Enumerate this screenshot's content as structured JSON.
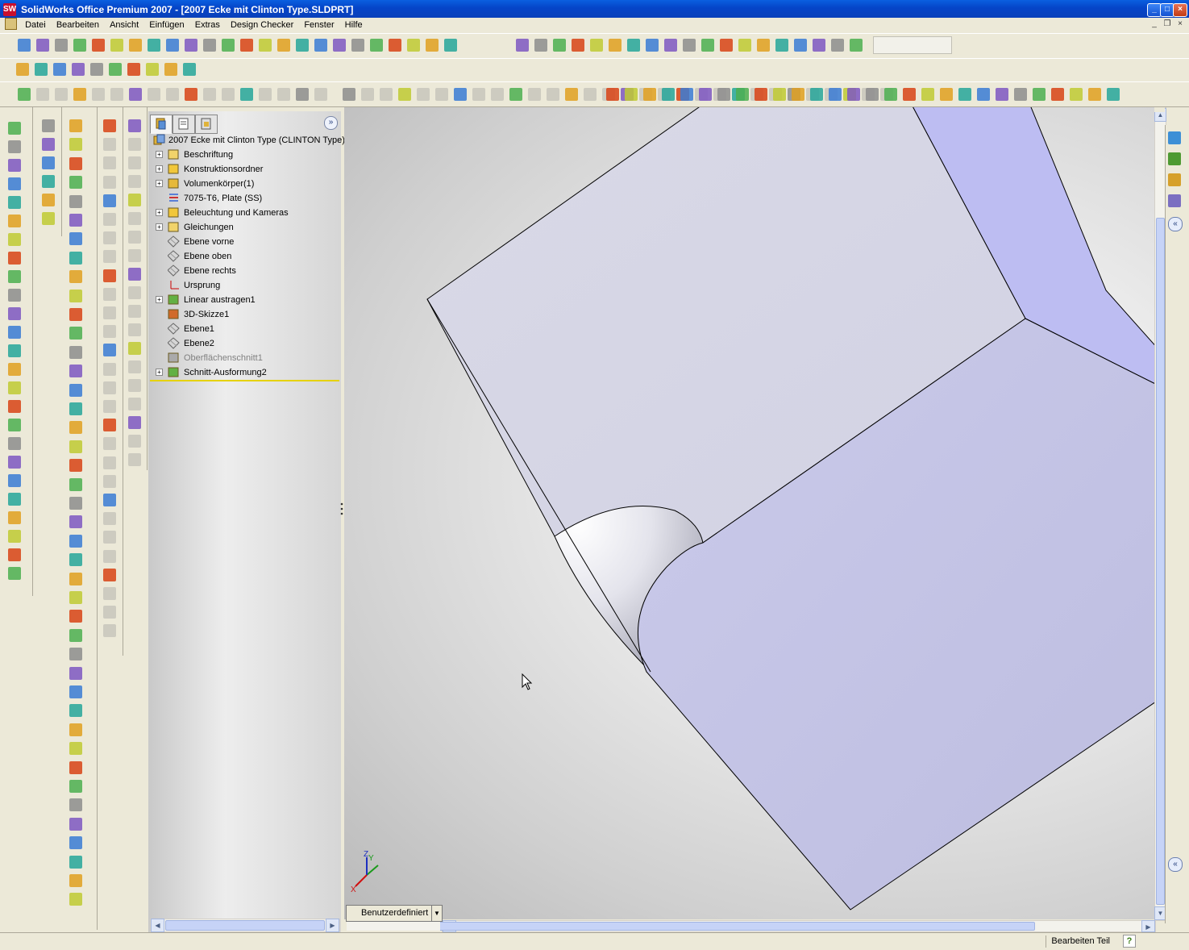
{
  "window": {
    "title": "SolidWorks Office Premium 2007 - [2007 Ecke mit Clinton Type.SLDPRT]",
    "app_icon_text": "SW",
    "min_label": "_",
    "max_label": "□",
    "close_label": "×"
  },
  "menu": [
    "Datei",
    "Bearbeiten",
    "Ansicht",
    "Einfügen",
    "Extras",
    "Design Checker",
    "Fenster",
    "Hilfe"
  ],
  "feature_tree": {
    "root": "2007 Ecke mit Clinton Type  (CLINTON Type)",
    "items": [
      {
        "label": "Beschriftung",
        "expandable": true,
        "dim": false,
        "icon": "annotation-icon"
      },
      {
        "label": "Konstruktionsordner",
        "expandable": true,
        "dim": false,
        "icon": "design-binder-icon"
      },
      {
        "label": "Volumenkörper(1)",
        "expandable": true,
        "dim": false,
        "icon": "solid-bodies-icon"
      },
      {
        "label": "7075-T6, Plate (SS)",
        "expandable": false,
        "dim": false,
        "icon": "material-icon"
      },
      {
        "label": "Beleuchtung und Kameras",
        "expandable": true,
        "dim": false,
        "icon": "lights-cameras-icon"
      },
      {
        "label": "Gleichungen",
        "expandable": true,
        "dim": false,
        "icon": "equations-icon"
      },
      {
        "label": "Ebene vorne",
        "expandable": false,
        "dim": false,
        "icon": "plane-icon"
      },
      {
        "label": "Ebene oben",
        "expandable": false,
        "dim": false,
        "icon": "plane-icon"
      },
      {
        "label": "Ebene rechts",
        "expandable": false,
        "dim": false,
        "icon": "plane-icon"
      },
      {
        "label": "Ursprung",
        "expandable": false,
        "dim": false,
        "icon": "origin-icon"
      },
      {
        "label": "Linear austragen1",
        "expandable": true,
        "dim": false,
        "icon": "extrude-icon"
      },
      {
        "label": "3D-Skizze1",
        "expandable": false,
        "dim": false,
        "icon": "3d-sketch-icon"
      },
      {
        "label": "Ebene1",
        "expandable": false,
        "dim": false,
        "icon": "plane-icon"
      },
      {
        "label": "Ebene2",
        "expandable": false,
        "dim": false,
        "icon": "plane-icon"
      },
      {
        "label": "Oberflächenschnitt1",
        "expandable": false,
        "dim": true,
        "icon": "surface-cut-icon"
      },
      {
        "label": "Schnitt-Ausformung2",
        "expandable": true,
        "dim": false,
        "icon": "loft-cut-icon"
      }
    ]
  },
  "view_orientation": "Benutzerdefiniert",
  "triad": {
    "z": "Z",
    "y": "Y",
    "x": "X"
  },
  "status": "Bearbeiten Teil",
  "help_glyph": "?",
  "colors": {
    "model_face": "#c6c6e8",
    "model_top_face": "#d6d6e6",
    "model_side_face": "#bcbcf0",
    "tree_rollback_bar": "#e6d200",
    "title_bar": "#0a4fd6"
  }
}
